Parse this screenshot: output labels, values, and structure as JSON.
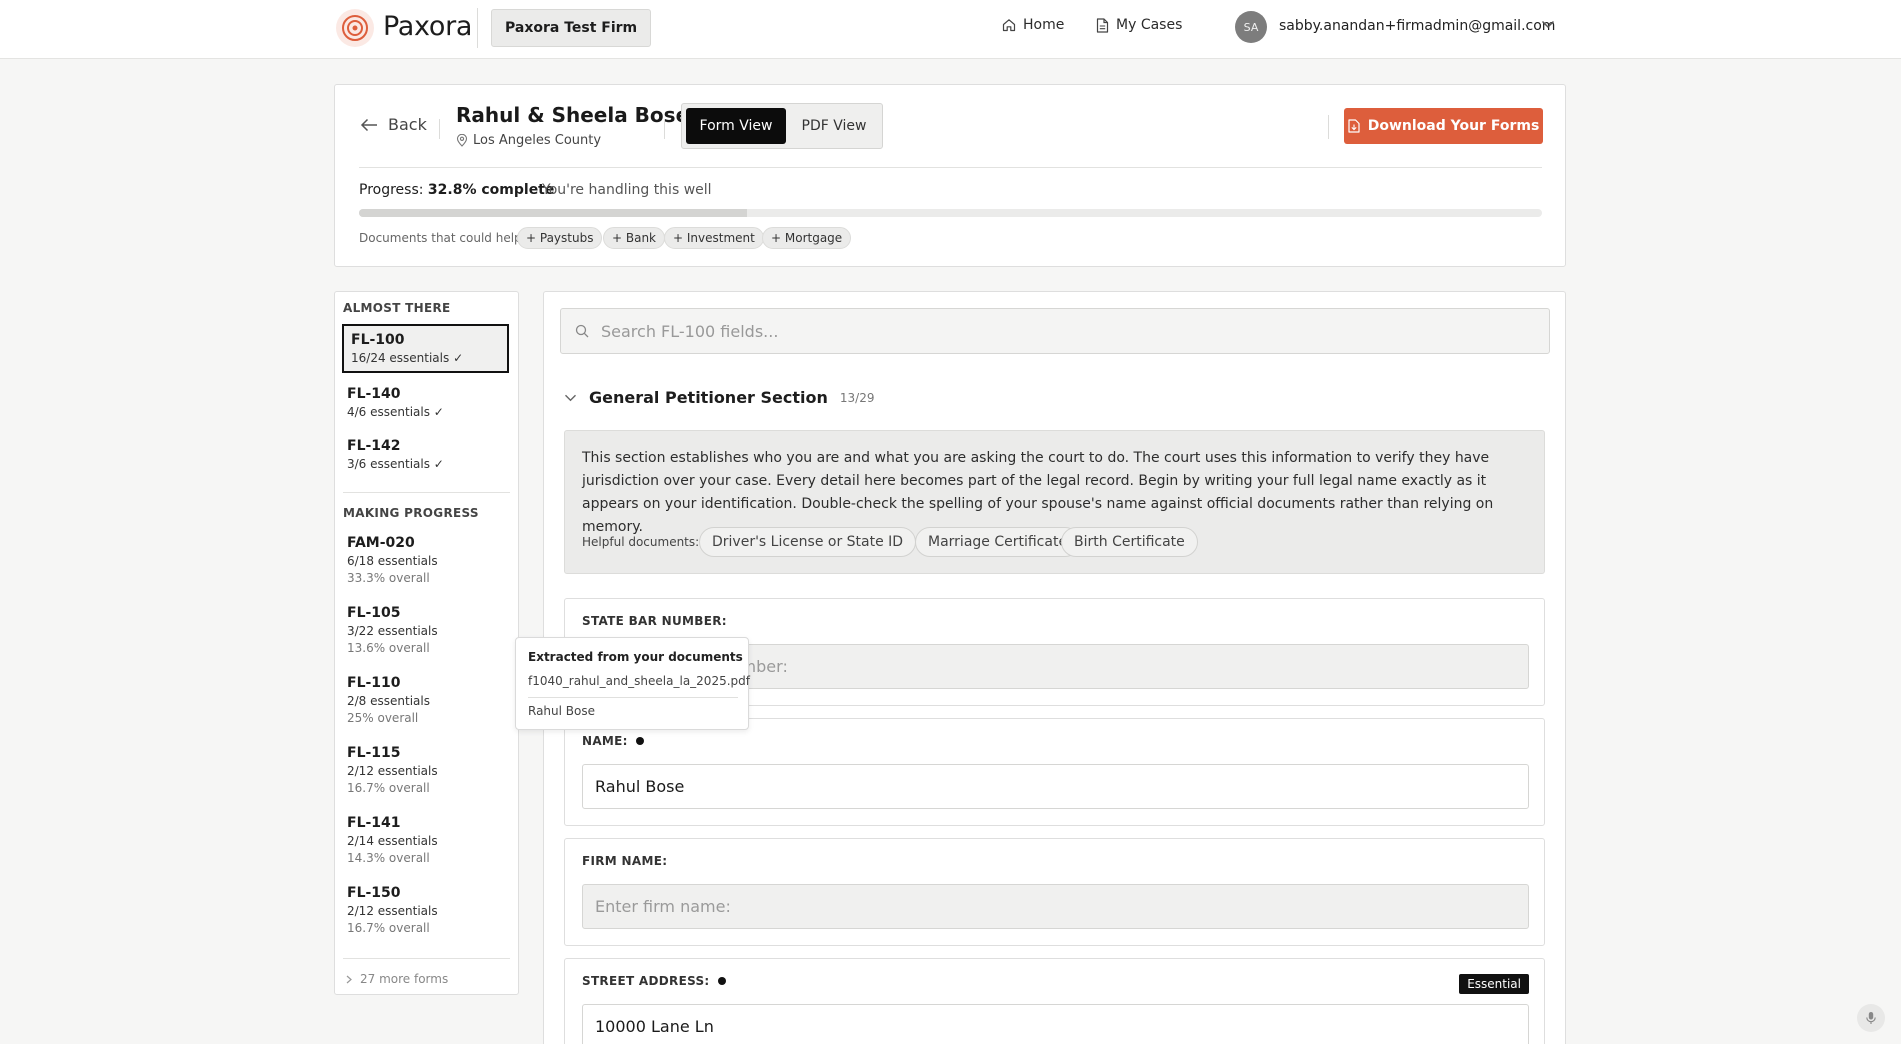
{
  "topbar": {
    "logo_text": "Paxora",
    "firm_name": "Paxora Test Firm",
    "nav_home": "Home",
    "nav_cases": "My Cases",
    "avatar_initials": "SA",
    "user_email": "sabby.anandan+firmadmin@gmail.com"
  },
  "colors": {
    "accent": "#dd5e3c",
    "selected_border": "#111111"
  },
  "case": {
    "back_label": "Back",
    "title": "Rahul & Sheela Bose",
    "county": "Los Angeles County",
    "view_form": "Form View",
    "view_pdf": "PDF View",
    "download_label": "Download Your Forms",
    "progress_prefix": "Progress:",
    "progress_value": "32.8% complete",
    "progress_fraction": 0.328,
    "progress_note": "You're handling this well",
    "docs_label": "Documents that could help:",
    "doc_chips": [
      "+ Paystubs",
      "+ Bank",
      "+ Investment",
      "+ Mortgage"
    ]
  },
  "sidebar": {
    "almost_heading": "ALMOST THERE",
    "almost": [
      {
        "name": "FL-100",
        "essentials": "16/24 essentials ✓",
        "selected": true
      },
      {
        "name": "FL-140",
        "essentials": "4/6 essentials ✓"
      },
      {
        "name": "FL-142",
        "essentials": "3/6 essentials ✓"
      }
    ],
    "progress_heading": "MAKING PROGRESS",
    "progress": [
      {
        "name": "FAM-020",
        "essentials": "6/18 essentials",
        "overall": "33.3% overall"
      },
      {
        "name": "FL-105",
        "essentials": "3/22 essentials",
        "overall": "13.6% overall"
      },
      {
        "name": "FL-110",
        "essentials": "2/8 essentials",
        "overall": "25% overall"
      },
      {
        "name": "FL-115",
        "essentials": "2/12 essentials",
        "overall": "16.7% overall"
      },
      {
        "name": "FL-141",
        "essentials": "2/14 essentials",
        "overall": "14.3% overall"
      },
      {
        "name": "FL-150",
        "essentials": "2/12 essentials",
        "overall": "16.7% overall"
      }
    ],
    "more_forms": "27 more forms"
  },
  "main": {
    "search_placeholder": "Search FL-100 fields...",
    "section_title": "General Petitioner Section",
    "section_count": "13/29",
    "info_text": "This section establishes who you are and what you are asking the court to do. The court uses this information to verify they have jurisdiction over your case. Every detail here becomes part of the legal record. Begin by writing your full legal name exactly as it appears on your identification. Double-check the spelling of your spouse's name against official documents rather than relying on memory.",
    "helpful_label": "Helpful documents:",
    "helpful_chips": [
      "Driver's License or State ID",
      "Marriage Certificate",
      "Birth Certificate"
    ],
    "fields": {
      "state_bar": {
        "label": "STATE BAR NUMBER:",
        "placeholder": "Enter state bar number:",
        "value": ""
      },
      "name": {
        "label": "NAME:",
        "value": "Rahul Bose"
      },
      "firm": {
        "label": "FIRM NAME:",
        "placeholder": "Enter firm name:",
        "value": ""
      },
      "street": {
        "label": "STREET ADDRESS:",
        "value": "10000 Lane Ln",
        "badge": "Essential"
      }
    }
  },
  "tooltip": {
    "title": "Extracted from your documents",
    "file": "f1040_rahul_and_sheela_la_2025.pdf",
    "value": "Rahul Bose"
  }
}
